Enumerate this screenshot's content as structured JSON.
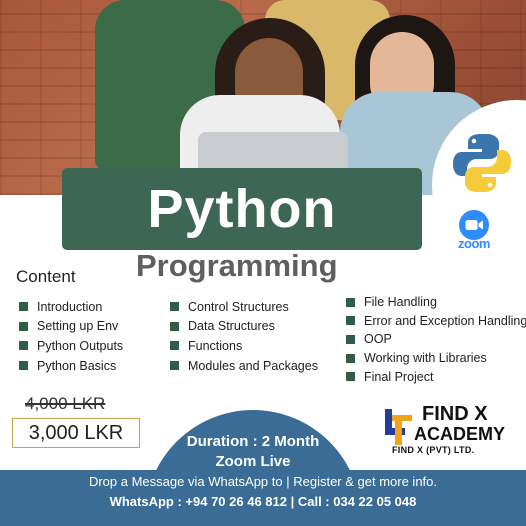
{
  "title": "Python",
  "subtitle": "Programming",
  "content_heading": "Content",
  "topics": {
    "col1": [
      "Introduction",
      "Setting up Env",
      "Python Outputs",
      "Python Basics"
    ],
    "col2": [
      "Control Structures",
      "Data Structures",
      "Functions",
      "Modules and Packages"
    ],
    "col3": [
      "File Handling",
      "Error and Exception Handling",
      "OOP",
      "Working with Libraries",
      "Final Project"
    ]
  },
  "price": {
    "old": "4,000 LKR",
    "new": "3,000 LKR"
  },
  "duration": {
    "line1": "Duration : 2 Month",
    "line2": "Zoom Live"
  },
  "brand": {
    "line1": "FIND X",
    "line2": "ACADEMY",
    "line3": "FIND X (PVT) LTD."
  },
  "zoom_label": "zoom",
  "contact": {
    "message": "Drop a Message via WhatsApp to  | Register & get more info.",
    "numbers": "WhatsApp : +94 70 26 46 812   | Call : 034 22 05 048"
  },
  "colors": {
    "title_bg": "#3e6654",
    "bullet": "#2f5d46",
    "band": "#3b6c96",
    "zoom": "#2d8cff",
    "price_border": "#c9a24e"
  },
  "icons": [
    "python-logo-icon",
    "zoom-camera-icon",
    "find-x-logo-icon"
  ]
}
